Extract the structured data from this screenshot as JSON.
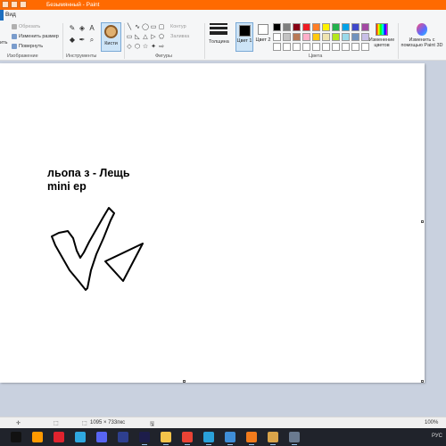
{
  "window": {
    "title": "Безымянный - Paint"
  },
  "menu": {
    "view_tab": "Вид"
  },
  "ribbon": {
    "image_group": {
      "label": "Изображение",
      "select_label": "ить",
      "crop_label": "Обрезать",
      "resize_label": "Изменить размер",
      "rotate_label": "Повернуть"
    },
    "tools_group": {
      "label": "Инструменты",
      "tools": [
        "✎",
        "◈",
        "A",
        "◆",
        "✒",
        "⌕"
      ]
    },
    "brushes": {
      "label": "Кисти"
    },
    "shapes_group": {
      "label": "Фигуры",
      "outline_label": "Контур",
      "fill_label": "Заливка",
      "shapes": [
        "╲",
        "∿",
        "◯",
        "▭",
        "▢",
        "▭",
        "◺",
        "△",
        "▷",
        "⬠",
        "◇",
        "⬡",
        "☆",
        "✦",
        "⇨"
      ]
    },
    "stroke_label": "Толщина",
    "color1_label": "Цвет 1",
    "color1": "#000000",
    "color2_label": "Цвет 2",
    "color2": "#ffffff",
    "colors_group_label": "Цвета",
    "palette": [
      "#000000",
      "#7f7f7f",
      "#880015",
      "#ed1c24",
      "#ff7f27",
      "#fff200",
      "#22b14c",
      "#00a2e8",
      "#3f48cc",
      "#a349a4",
      "#ffffff",
      "#c3c3c3",
      "#b97a57",
      "#ffaec9",
      "#ffc90e",
      "#efe4b0",
      "#b5e61d",
      "#99d9ea",
      "#7092be",
      "#c8bfe7",
      "#ffffff",
      "#ffffff",
      "#ffffff",
      "#ffffff",
      "#ffffff",
      "#ffffff",
      "#ffffff",
      "#ffffff",
      "#ffffff",
      "#ffffff"
    ],
    "edit_colors_label": "Изменение цветов",
    "paint3d_label": "Изменить с помощью Paint 3D"
  },
  "canvas": {
    "text_line1": "льопа з - Лещь",
    "text_line2": "mini ep"
  },
  "status": {
    "size": "1095 × 733пкс",
    "zoom": "100%"
  },
  "taskbar": {
    "lang": "РУС",
    "icons": [
      {
        "name": "tiktok-icon",
        "color": "#111111"
      },
      {
        "name": "illustrator-icon",
        "color": "#ff9a00"
      },
      {
        "name": "opera-icon",
        "color": "#e0232e"
      },
      {
        "name": "chrome-like-icon",
        "color": "#2fa8e0"
      },
      {
        "name": "discord-icon",
        "color": "#5865f2"
      },
      {
        "name": "photoshop-icon",
        "color": "#2e3f8f"
      },
      {
        "name": "premiere-icon",
        "color": "#1d1d4a"
      },
      {
        "name": "file-explorer-icon",
        "color": "#f3c44a"
      },
      {
        "name": "chrome-icon",
        "color": "#ea4335"
      },
      {
        "name": "telegram-icon",
        "color": "#2aa1da"
      },
      {
        "name": "windows-store-icon",
        "color": "#3f8ed8"
      },
      {
        "name": "fl-studio-icon",
        "color": "#f27b1c"
      },
      {
        "name": "paint-icon",
        "color": "#d9a44a"
      },
      {
        "name": "app-icon",
        "color": "#6a7a90"
      }
    ]
  }
}
